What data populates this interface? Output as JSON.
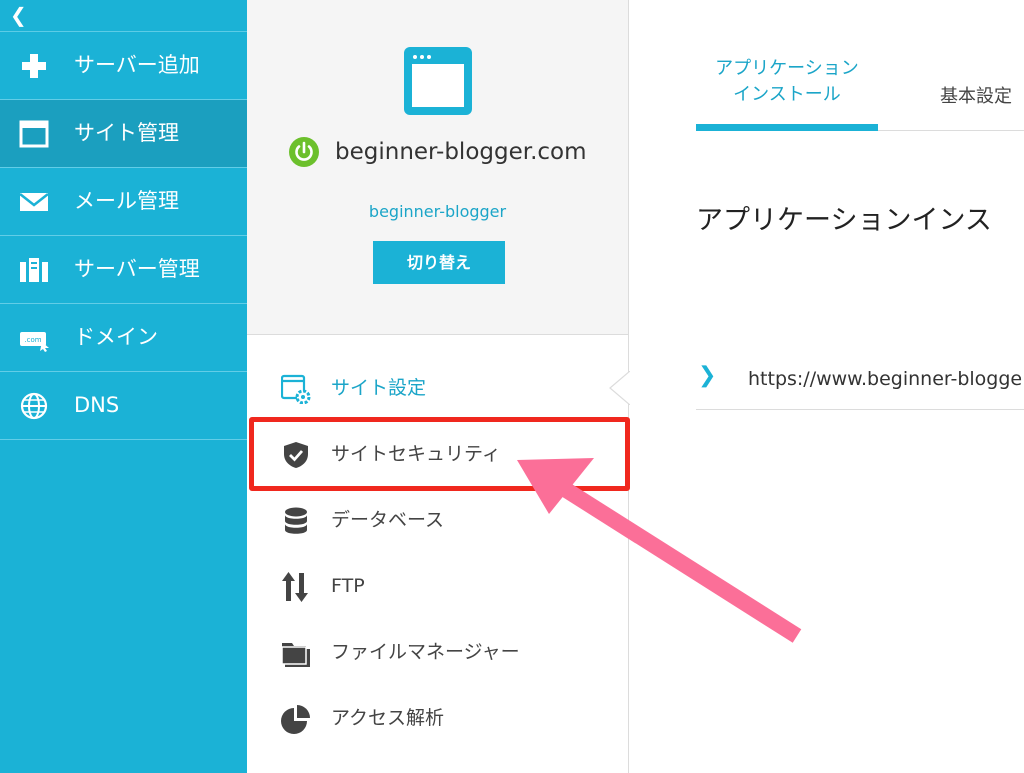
{
  "nav": {
    "collapse_glyph": "❮",
    "items": [
      {
        "label": "サーバー追加",
        "icon": "plus-icon"
      },
      {
        "label": "サイト管理",
        "icon": "window-icon"
      },
      {
        "label": "メール管理",
        "icon": "mail-icon"
      },
      {
        "label": "サーバー管理",
        "icon": "server-icon"
      },
      {
        "label": "ドメイン",
        "icon": "domain-icon"
      },
      {
        "label": "DNS",
        "icon": "globe-icon"
      }
    ]
  },
  "site": {
    "domain": "beginner-blogger.com",
    "account": "beginner-blogger",
    "switch_label": "切り替え"
  },
  "menu": {
    "items": [
      {
        "label": "サイト設定",
        "icon": "site-settings-icon"
      },
      {
        "label": "サイトセキュリティ",
        "icon": "shield-icon"
      },
      {
        "label": "データベース",
        "icon": "database-icon"
      },
      {
        "label": "FTP",
        "icon": "transfer-icon"
      },
      {
        "label": "ファイルマネージャー",
        "icon": "folder-icon"
      },
      {
        "label": "アクセス解析",
        "icon": "pie-chart-icon"
      }
    ]
  },
  "content": {
    "tabs": [
      "アプリケーション\nインストール",
      "基本設定"
    ],
    "title": "アプリケーションインス",
    "url": "https://www.beginner-blogge",
    "chevron": "❯"
  },
  "colors": {
    "nav_bg": "#1bb2d6",
    "nav_active": "#1b9fbf",
    "accent": "#1ba5c8",
    "power_green": "#6cc02c",
    "highlight_red": "#f0281e",
    "arrow_pink": "#fb6f98"
  }
}
